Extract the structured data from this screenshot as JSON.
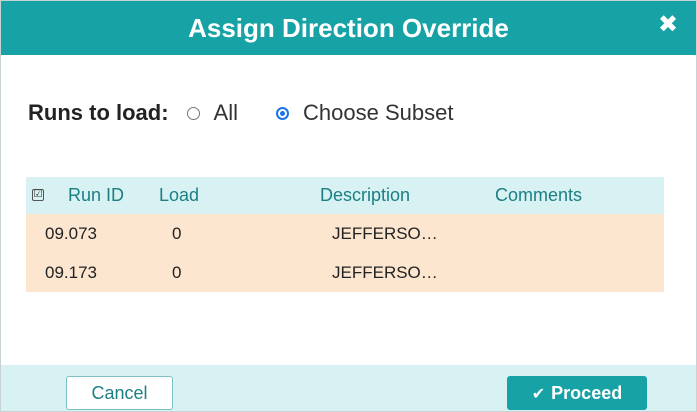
{
  "dialog": {
    "title": "Assign Direction Override",
    "close_glyph": "✖"
  },
  "runs": {
    "label": "Runs to load:",
    "options": [
      {
        "label": "All",
        "selected": false
      },
      {
        "label": "Choose Subset",
        "selected": true
      }
    ]
  },
  "table": {
    "select_all_glyph": "☑",
    "columns": [
      "Run ID",
      "Load",
      "Description",
      "Comments"
    ],
    "rows": [
      {
        "run_id": "09.073",
        "load": "0",
        "description": "JEFFERSO…",
        "comments": ""
      },
      {
        "run_id": "09.173",
        "load": "0",
        "description": "JEFFERSO…",
        "comments": ""
      }
    ]
  },
  "footer": {
    "cancel_label": "Cancel",
    "proceed_label": "Proceed",
    "proceed_icon": "✔"
  },
  "colors": {
    "accent": "#17a2a6",
    "header_bg": "#d8f2f3",
    "row_bg": "#fde6cf",
    "radio_selected": "#1a73e8"
  }
}
